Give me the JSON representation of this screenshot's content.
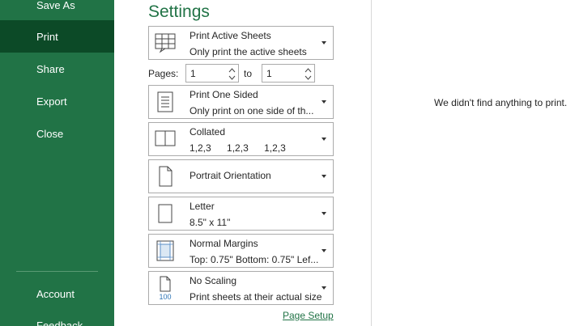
{
  "nav": {
    "items": [
      {
        "label": "Save As"
      },
      {
        "label": "Print"
      },
      {
        "label": "Share"
      },
      {
        "label": "Export"
      },
      {
        "label": "Close"
      },
      {
        "label": "Account"
      },
      {
        "label": "Feedback"
      }
    ]
  },
  "settings": {
    "title": "Settings",
    "print_what": {
      "line1": "Print Active Sheets",
      "line2": "Only print the active sheets",
      "icon": "sheets-grid-icon"
    },
    "pages": {
      "label": "Pages:",
      "from_value": "1",
      "to_label": "to",
      "to_value": "1"
    },
    "sided": {
      "line1": "Print One Sided",
      "line2": "Only print on one side of th...",
      "icon": "one-sided-page-icon"
    },
    "collation": {
      "line1": "Collated",
      "line2": [
        "1,2,3",
        "1,2,3",
        "1,2,3"
      ],
      "icon": "collated-pages-icon"
    },
    "orientation": {
      "line1": "Portrait Orientation",
      "icon": "portrait-page-icon"
    },
    "paper": {
      "line1": "Letter",
      "line2": "8.5\" x 11\"",
      "icon": "paper-size-icon"
    },
    "margins": {
      "line1": "Normal Margins",
      "line2": "Top: 0.75\" Bottom: 0.75\" Lef...",
      "icon": "margins-icon"
    },
    "scaling": {
      "line1": "No Scaling",
      "line2": "Print sheets at their actual size",
      "icon": "scaling-100-icon",
      "icon_text": "100"
    },
    "page_setup_link": "Page Setup"
  },
  "preview": {
    "message": "We didn't find anything to print."
  },
  "colors": {
    "nav_bg": "#217346",
    "nav_active": "#0c4a27",
    "accent": "#217346"
  }
}
